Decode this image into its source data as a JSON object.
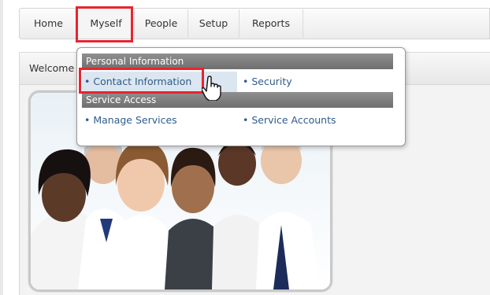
{
  "nav": {
    "tabs": [
      "Home",
      "Myself",
      "People",
      "Setup",
      "Reports"
    ],
    "active": "Myself"
  },
  "panel": {
    "title": "Welcome"
  },
  "menu": {
    "personal_header": "Personal Information",
    "contact_information": "• Contact Information",
    "security": "• Security",
    "service_header": "Service Access",
    "manage_services": "• Manage Services",
    "service_accounts": "• Service Accounts"
  },
  "colors": {
    "highlight": "#e8242f",
    "link": "#2f5c8c",
    "section_header": "#7a7a7a"
  },
  "icons": [
    "hand-pointer-cursor-icon"
  ]
}
